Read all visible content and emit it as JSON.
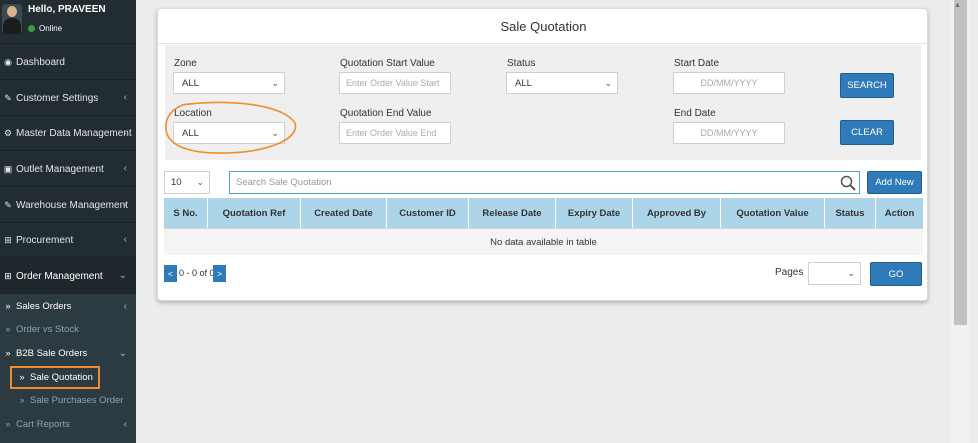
{
  "user": {
    "greeting": "Hello, PRAVEEN",
    "status": "Online"
  },
  "sidebar": {
    "items": [
      {
        "label": "Dashboard",
        "icon": "dashboard-icon",
        "glyph": "◉",
        "chevron": ""
      },
      {
        "label": "Customer Settings",
        "icon": "wrench-icon",
        "glyph": "✎",
        "chevron": "‹"
      },
      {
        "label": "Master Data Management",
        "icon": "gear-icon",
        "glyph": "⚙",
        "chevron": "‹"
      },
      {
        "label": "Outlet Management",
        "icon": "outlet-icon",
        "glyph": "▣",
        "chevron": "‹"
      },
      {
        "label": "Warehouse Management",
        "icon": "wrench-icon",
        "glyph": "✎",
        "chevron": "‹"
      },
      {
        "label": "Procurement",
        "icon": "cart-icon",
        "glyph": "⊞",
        "chevron": "‹"
      },
      {
        "label": "Order Management",
        "icon": "cart-icon",
        "glyph": "⊞",
        "chevron": "⌄"
      }
    ],
    "sub_items": [
      {
        "label": "Sales Orders",
        "glyph": "»",
        "chevron": "‹"
      },
      {
        "label": "Order vs Stock",
        "glyph": "»",
        "chevron": ""
      },
      {
        "label": "B2B Sale Orders",
        "glyph": "»",
        "chevron": "⌄"
      },
      {
        "label": "Sale Quotation",
        "glyph": "»",
        "chevron": ""
      },
      {
        "label": "Sale Purchases Order",
        "glyph": "»",
        "chevron": ""
      },
      {
        "label": "Cart Reports",
        "glyph": "»",
        "chevron": "‹"
      }
    ]
  },
  "page": {
    "title": "Sale Quotation"
  },
  "filters": {
    "zone": {
      "label": "Zone",
      "value": "ALL"
    },
    "location": {
      "label": "Location",
      "value": "ALL"
    },
    "quotation_start": {
      "label": "Quotation Start Value",
      "placeholder": "Enter Order Value Start"
    },
    "quotation_end": {
      "label": "Quotation End Value",
      "placeholder": "Enter Order Value End"
    },
    "status": {
      "label": "Status",
      "value": "ALL"
    },
    "start_date": {
      "label": "Start Date",
      "placeholder": "DD/MM/YYYY"
    },
    "end_date": {
      "label": "End Date",
      "placeholder": "DD/MM/YYYY"
    },
    "search_button": "SEARCH",
    "clear_button": "CLEAR"
  },
  "table": {
    "page_length": "10",
    "search_placeholder": "Search Sale Quotation",
    "add_button": "Add New",
    "columns": [
      "S No.",
      "Quotation Ref",
      "Created Date",
      "Customer ID",
      "Release Date",
      "Expiry Date",
      "Approved By",
      "Quotation Value",
      "Status",
      "Action"
    ],
    "empty_message": "No data available in table"
  },
  "pagination": {
    "prev": "<",
    "next": ">",
    "info": "0 - 0 of 0",
    "pages_label": "Pages",
    "go_button": "GO"
  },
  "colors": {
    "sidebar": "#222d32",
    "accent": "#2f7ab9",
    "table_header": "#acd5ea",
    "annotation": "#f08c2d"
  }
}
